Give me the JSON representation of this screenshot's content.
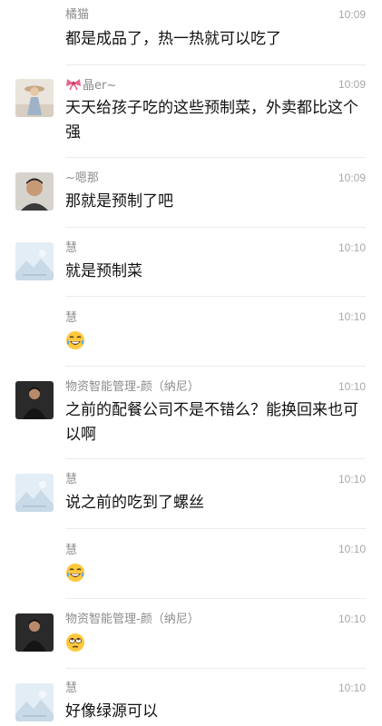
{
  "messages": [
    {
      "name": "橘猫",
      "time": "10:09",
      "text": "都是成品了，热一热就可以吃了",
      "avatar": "none"
    },
    {
      "name": "晶er~",
      "name_prefix_icon": "ribbon-bow-icon",
      "time": "10:09",
      "text": "天天给孩子吃的这些预制菜，外卖都比这个强",
      "avatar": "girl-photo"
    },
    {
      "name": "~嗯那",
      "time": "10:09",
      "text": "那就是预制了吧",
      "avatar": "man-photo"
    },
    {
      "name": "慧",
      "time": "10:10",
      "text": "就是预制菜",
      "avatar": "landscape-placeholder"
    },
    {
      "name": "慧",
      "time": "10:10",
      "emoji": "laughing-tears-emoji",
      "avatar": "none"
    },
    {
      "name": "物资智能管理-颜（纳尼）",
      "time": "10:10",
      "text": "之前的配餐公司不是不错么？能换回来也可以啊",
      "avatar": "man-dark-photo"
    },
    {
      "name": "慧",
      "time": "10:10",
      "text": "说之前的吃到了螺丝",
      "avatar": "landscape-placeholder"
    },
    {
      "name": "慧",
      "time": "10:10",
      "emoji": "laughing-tears-emoji",
      "avatar": "none"
    },
    {
      "name": "物资智能管理-颜（纳尼）",
      "time": "10:10",
      "emoji": "eye-roll-emoji",
      "avatar": "man-dark-photo"
    },
    {
      "name": "慧",
      "time": "10:10",
      "text": "好像绿源可以",
      "avatar": "landscape-placeholder"
    }
  ],
  "colors": {
    "name": "#8c8c8c",
    "time": "#a8a8a8",
    "text": "#111111",
    "divider": "#ececec"
  }
}
